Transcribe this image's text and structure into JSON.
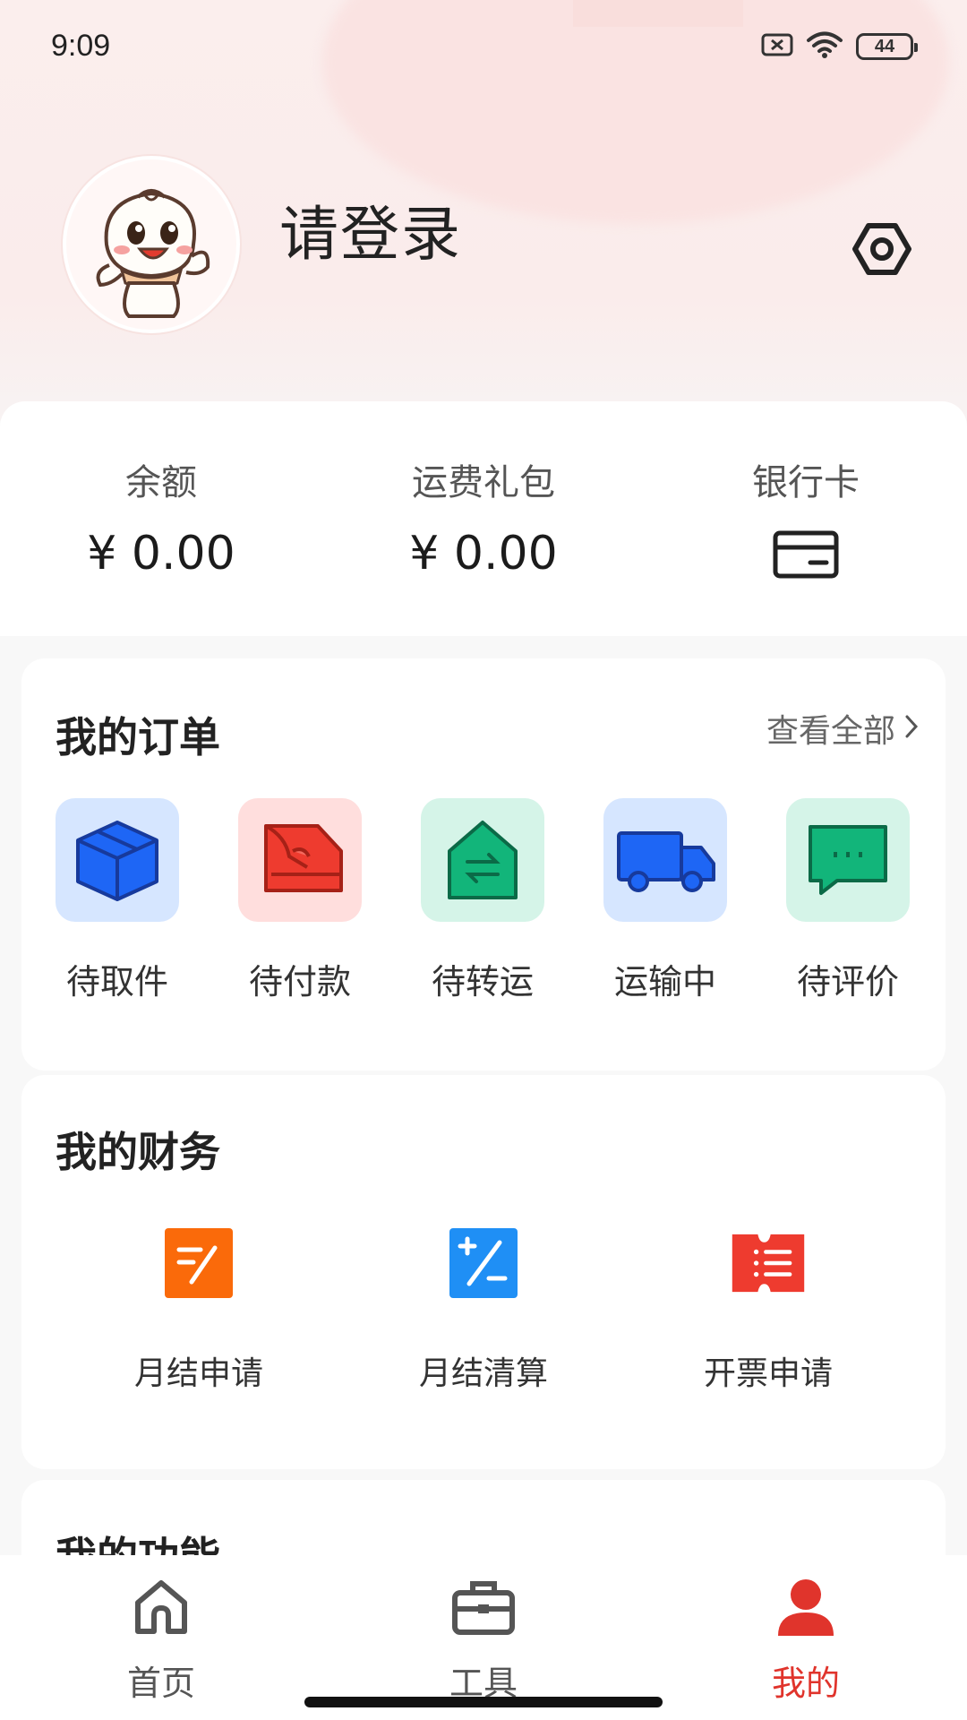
{
  "status_bar": {
    "time": "9:09",
    "battery": "44"
  },
  "profile": {
    "login_prompt": "请登录"
  },
  "wallet": {
    "balance_label": "余额",
    "balance_value": "¥ 0.00",
    "freight_label": "运费礼包",
    "freight_value": "¥ 0.00",
    "bank_card_label": "银行卡"
  },
  "orders": {
    "title": "我的订单",
    "view_all": "查看全部",
    "items": [
      {
        "label": "待取件",
        "icon": "package-icon",
        "bg": "#d6e6ff",
        "color": "#1e66f5"
      },
      {
        "label": "待付款",
        "icon": "payment-icon",
        "bg": "#ffdedd",
        "color": "#ee3b2f"
      },
      {
        "label": "待转运",
        "icon": "transfer-icon",
        "bg": "#d5f4e8",
        "color": "#12b57a"
      },
      {
        "label": "运输中",
        "icon": "truck-icon",
        "bg": "#d6e6ff",
        "color": "#1e66f5"
      },
      {
        "label": "待评价",
        "icon": "comment-icon",
        "bg": "#d5f4e8",
        "color": "#12b57a"
      }
    ]
  },
  "finance": {
    "title": "我的财务",
    "items": [
      {
        "label": "月结申请",
        "icon": "monthly-apply-icon",
        "color": "#fa6a0a"
      },
      {
        "label": "月结清算",
        "icon": "monthly-settle-icon",
        "color": "#1f8ff5"
      },
      {
        "label": "开票申请",
        "icon": "invoice-icon",
        "color": "#ee3b2f"
      }
    ]
  },
  "functions": {
    "title": "我的功能"
  },
  "bottom_nav": {
    "items": [
      {
        "label": "首页",
        "icon": "home-icon",
        "active": false
      },
      {
        "label": "工具",
        "icon": "toolbox-icon",
        "active": false
      },
      {
        "label": "我的",
        "icon": "user-icon",
        "active": true
      }
    ],
    "active_color": "#e0342c"
  }
}
